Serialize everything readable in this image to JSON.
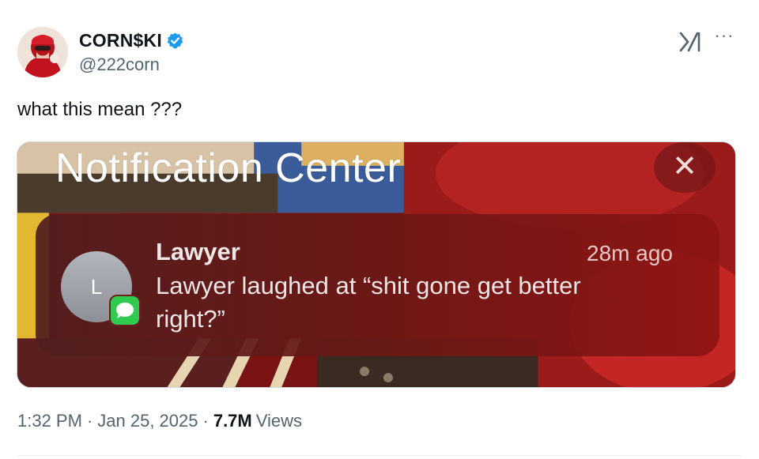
{
  "author": {
    "display_name": "CORN$KI",
    "handle": "@222corn",
    "verified": true,
    "verified_color": "#1d9bf0"
  },
  "header_actions": {
    "logo_icon": "x-grok-logo-icon",
    "more_label": "···"
  },
  "tweet": {
    "text": "what this mean ???"
  },
  "media": {
    "title": "Notification Center",
    "close_label": "✕",
    "notification": {
      "avatar_initial": "L",
      "sender": "Lawyer",
      "time_ago": "28m ago",
      "message": "Lawyer laughed at “shit gone get better right?”",
      "app_icon": "messages-icon"
    }
  },
  "meta": {
    "time": "1:32 PM",
    "date": "Jan 25, 2025",
    "separator": "·",
    "views_count": "7.7M",
    "views_label": "Views"
  }
}
